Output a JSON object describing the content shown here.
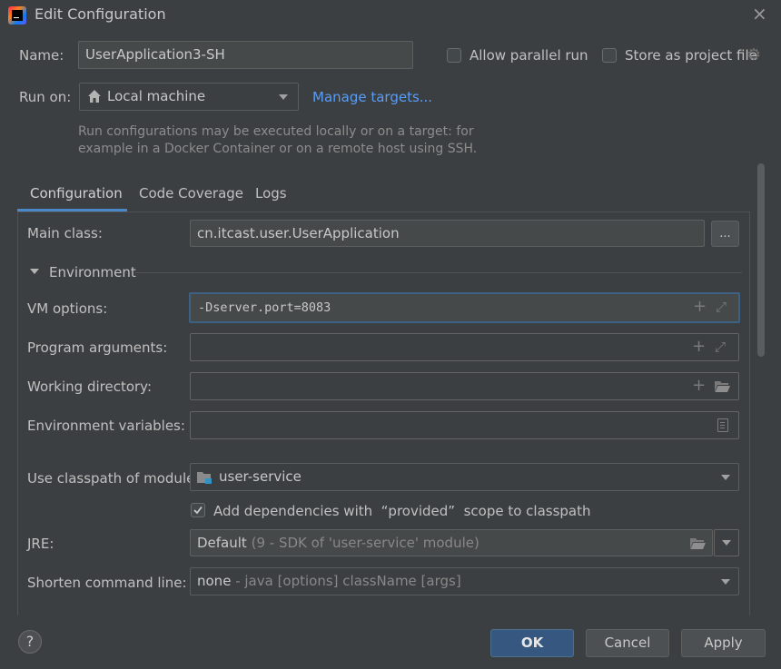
{
  "window": {
    "title": "Edit Configuration",
    "close_glyph": "×"
  },
  "top": {
    "name_label": "Name:",
    "name_value": "UserApplication3-SH",
    "allow_parallel_label": "Allow parallel run",
    "allow_parallel_checked": false,
    "store_project_label": "Store as project file",
    "store_project_checked": false
  },
  "run_on": {
    "label": "Run on:",
    "value": "Local machine",
    "manage_targets": "Manage targets...",
    "hint": "Run configurations may be executed locally or on a target: for example in a Docker Container or on a remote host using SSH."
  },
  "tabs": [
    {
      "label": "Configuration",
      "active": true
    },
    {
      "label": "Code Coverage",
      "active": false
    },
    {
      "label": "Logs",
      "active": false
    }
  ],
  "config": {
    "main_class_label": "Main class:",
    "main_class_value": "cn.itcast.user.UserApplication",
    "browse_label": "...",
    "environment_label": "Environment",
    "vm_options_label": "VM options:",
    "vm_options_value": "-Dserver.port=8083",
    "program_args_label": "Program arguments:",
    "program_args_value": "",
    "working_dir_label": "Working directory:",
    "working_dir_value": "",
    "env_vars_label": "Environment variables:",
    "env_vars_value": "",
    "classpath_label": "Use classpath of module:",
    "classpath_value": "user-service",
    "add_deps_label": "Add dependencies with  “provided”  scope to classpath",
    "add_deps_checked": true,
    "jre_label": "JRE:",
    "jre_value": "Default",
    "jre_detail": "(9 - SDK of 'user-service' module)",
    "shorten_label": "Shorten command line:",
    "shorten_value": "none",
    "shorten_detail": "- java [options] className [args]"
  },
  "footer": {
    "help": "?",
    "ok": "OK",
    "cancel": "Cancel",
    "apply": "Apply"
  },
  "colors": {
    "accent": "#4a88c7",
    "link": "#589df6",
    "primary_button": "#365880",
    "background": "#3c3f41"
  }
}
